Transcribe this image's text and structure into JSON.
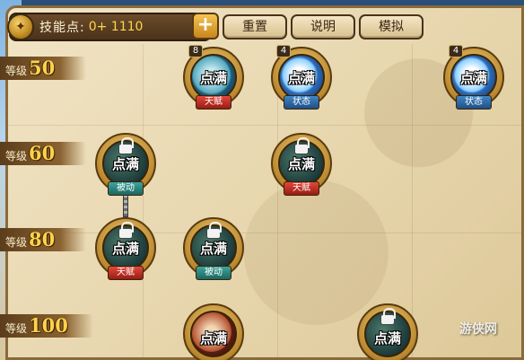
{
  "toolbar": {
    "skill_points_label": "技能点: ",
    "skill_points_value": "0+ 1110",
    "plus_label": "+",
    "reset_label": "重置",
    "info_label": "说明",
    "simulate_label": "模拟"
  },
  "levels": [
    {
      "label": "等级",
      "value": "50"
    },
    {
      "label": "等级",
      "value": "60"
    },
    {
      "label": "等级",
      "value": "80"
    },
    {
      "label": "等级",
      "value": "100"
    }
  ],
  "skills": [
    {
      "status": "点满",
      "tag": "天赋",
      "badge": "8",
      "style": "teal",
      "tag_style": "red"
    },
    {
      "status": "点满",
      "tag": "状态",
      "badge": "4",
      "style": "blue",
      "tag_style": "blue"
    },
    {
      "status": "点满",
      "tag": "状态",
      "badge": "4",
      "style": "blue",
      "tag_style": "blue"
    },
    {
      "status": "点满",
      "tag": "被动",
      "style": "dark",
      "tag_style": "teal"
    },
    {
      "status": "点满",
      "tag": "天赋",
      "style": "dark",
      "tag_style": "red"
    },
    {
      "status": "点满",
      "tag": "天赋",
      "style": "dark",
      "tag_style": "red"
    },
    {
      "status": "点满",
      "tag": "被动",
      "style": "dark",
      "tag_style": "teal"
    },
    {
      "status": "点满",
      "style": "red"
    },
    {
      "status": "点满",
      "style": "dark"
    }
  ],
  "colors": {
    "level_number": "#ffd24a",
    "skill_points_value": "#ffd54a",
    "tag_talent": "#c0302a",
    "tag_state": "#2f6aaa",
    "tag_passive": "#2a857d"
  },
  "watermark": "游侠网"
}
